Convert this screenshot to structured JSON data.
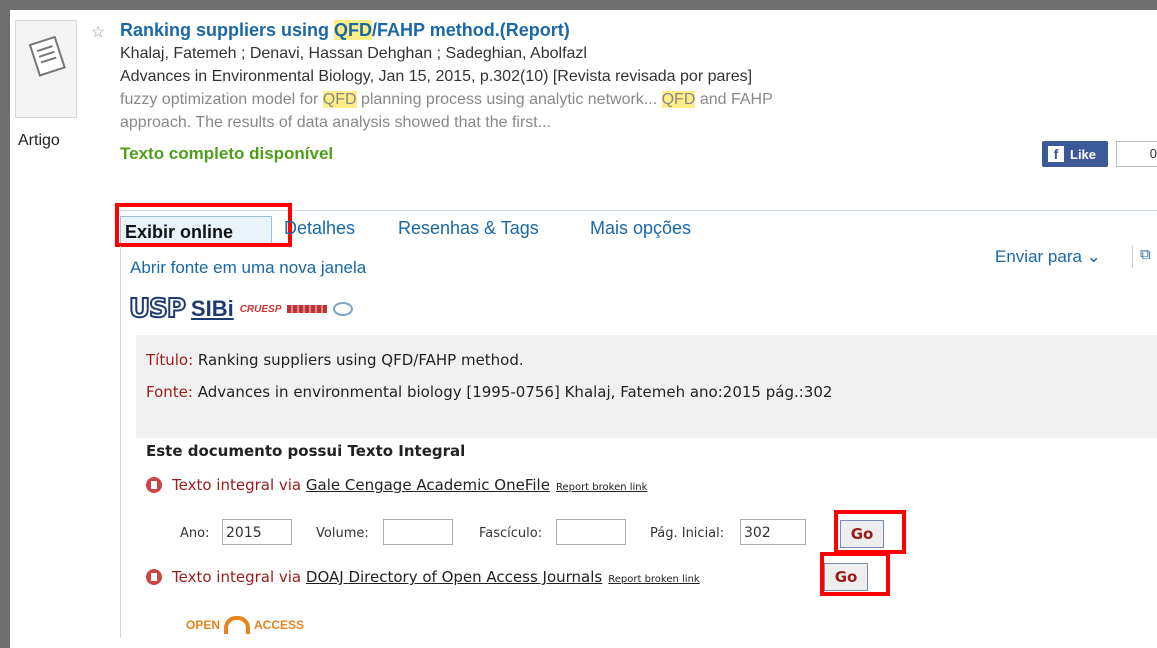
{
  "record": {
    "type_label": "Artigo",
    "title": {
      "pre": "Ranking suppliers using ",
      "hl": "QFD",
      "post": "/FAHP method.(Report)"
    },
    "authors": "Khalaj, Fatemeh ; Denavi, Hassan Dehghan ; Sadeghian, Abolfazl",
    "source": "Advances in Environmental Biology, Jan 15, 2015, p.302(10) [Revista revisada por pares]",
    "snippet1": {
      "pre": "fuzzy optimization model for ",
      "hl": "QFD",
      "mid": " planning process using analytic network... ",
      "hl2": "QFD",
      "post": " and FAHP"
    },
    "snippet2": "approach. The results of data analysis showed that the first...",
    "fulltext_available": "Texto completo disponível",
    "like_label": "Like",
    "like_count": "0"
  },
  "tabs": [
    {
      "label": "Exibir online",
      "active": true
    },
    {
      "label": "Detalhes"
    },
    {
      "label": "Resenhas & Tags"
    },
    {
      "label": "Mais opções"
    }
  ],
  "toolbar": {
    "open_new_window": "Abrir fonte em uma nova janela",
    "send_to": "Enviar para",
    "send_to_chevron": "⌄"
  },
  "logos": {
    "usp": "USP",
    "sibi": "SIBi",
    "cruesp": "CRUESP"
  },
  "citation": {
    "title_label": "Título:",
    "title_value": "Ranking suppliers using QFD/FAHP method.",
    "source_label": "Fonte:",
    "source_value": "Advances in environmental biology [1995-0756] Khalaj, Fatemeh ano:2015 pág.:302"
  },
  "fulltext": {
    "heading": "Este documento possui Texto Integral",
    "via": "Texto integral via",
    "provider1": "Gale Cengage Academic OneFile",
    "provider2": "DOAJ Directory of Open Access Journals",
    "report": "Report broken link",
    "go": "Go",
    "fields": {
      "ano_label": "Ano:",
      "ano_value": "2015",
      "volume_label": "Volume:",
      "volume_value": "",
      "fasciculo_label": "Fascículo:",
      "fasciculo_value": "",
      "pag_label": "Pág. Inicial:",
      "pag_value": "302"
    }
  },
  "open_access": {
    "open": "OPEN",
    "access": "ACCESS"
  },
  "colors": {
    "link": "#1a68a6",
    "highlight_box": "#ff0000",
    "available": "#4f9e1b",
    "accent": "#9b1b1b"
  }
}
